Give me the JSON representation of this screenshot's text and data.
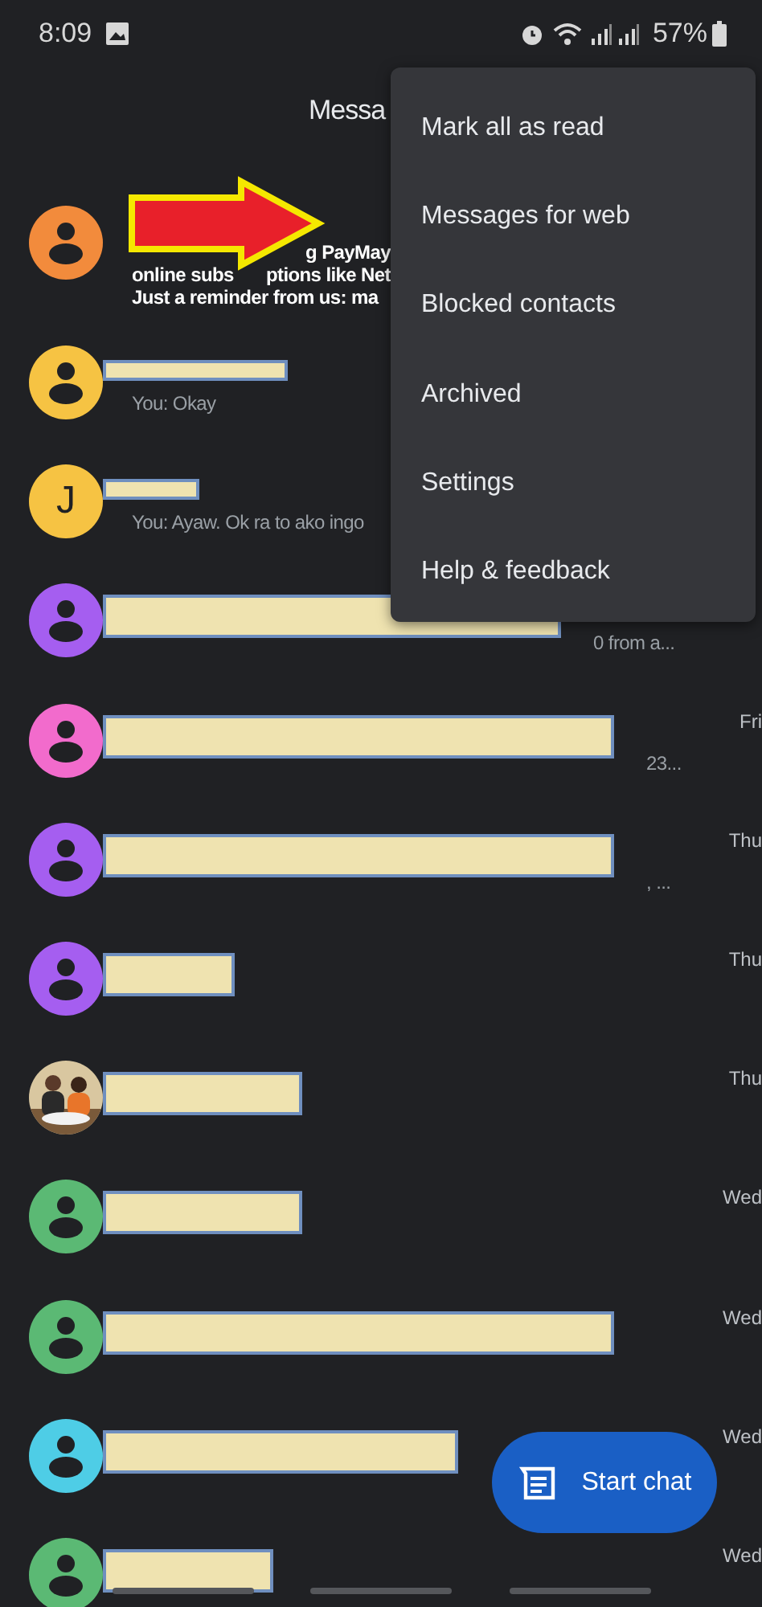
{
  "status_bar": {
    "time": "8:09",
    "battery": "57%"
  },
  "title": "Messa",
  "menu": {
    "items": [
      "Mark all as read",
      "Messages for web",
      "Blocked contacts",
      "Archived",
      "Settings",
      "Help & feedback"
    ]
  },
  "conversations": [
    {
      "kind": "plain",
      "avatar": {
        "kind": "person",
        "color": "#f28b3c"
      },
      "unread": true,
      "lines": [
        [
          "g PayMay"
        ],
        [
          "online subs",
          "ptions like Net"
        ],
        [
          "Just a reminder from us: ma"
        ]
      ]
    },
    {
      "kind": "namehidden-m",
      "avatar": {
        "kind": "person",
        "color": "#f6c343"
      },
      "unread": false,
      "lines": [
        [
          "You: Okay"
        ]
      ]
    },
    {
      "kind": "namehidden-xs",
      "avatar": {
        "kind": "letter",
        "letter": "J",
        "color": "#f6c343"
      },
      "unread": false,
      "lines": [
        [
          "You: Ayaw. Ok ra to ako ingo"
        ]
      ]
    },
    {
      "kind": "hidden-xl",
      "avatar": {
        "kind": "person",
        "color": "#a55ef0"
      },
      "unread": false,
      "lines": [
        [
          "0 from a..."
        ]
      ]
    },
    {
      "kind": "hidden-xxl",
      "avatar": {
        "kind": "person",
        "color": "#f26bcc"
      },
      "unread": false,
      "time": "Fri",
      "lines": [
        [
          "23..."
        ]
      ]
    },
    {
      "kind": "hidden-xxl",
      "avatar": {
        "kind": "person",
        "color": "#a55ef0"
      },
      "unread": false,
      "time": "Thu",
      "lines": [
        [
          ", ..."
        ]
      ]
    },
    {
      "kind": "hidden-s",
      "avatar": {
        "kind": "person",
        "color": "#a55ef0"
      },
      "unread": false,
      "time": "Thu"
    },
    {
      "kind": "hidden-m",
      "unread": false,
      "time": "Thu"
    },
    {
      "kind": "hidden-m",
      "avatar": {
        "kind": "person",
        "color": "#5bb974"
      },
      "unread": false,
      "time": "Wed"
    },
    {
      "kind": "hidden-xxl",
      "avatar": {
        "kind": "person",
        "color": "#5bb974"
      },
      "unread": false,
      "time": "Wed"
    },
    {
      "kind": "hidden-l",
      "avatar": {
        "kind": "person",
        "color": "#4ecde6"
      },
      "unread": false,
      "time": "Wed"
    },
    {
      "kind": "hidden-sm",
      "avatar": {
        "kind": "person",
        "color": "#5bb974"
      },
      "unread": false,
      "time": "Wed"
    }
  ],
  "fab": {
    "label": "Start chat"
  }
}
